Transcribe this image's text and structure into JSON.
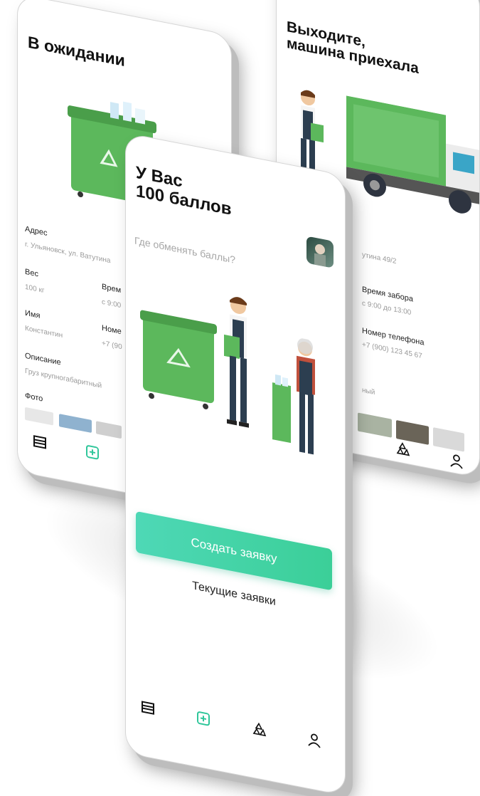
{
  "screens": {
    "waiting": {
      "title": "В ожидании",
      "fields": {
        "address_label": "Адрес",
        "address_value": "г. Ульяновск, ул. Ватутина",
        "weight_label": "Вес",
        "weight_value": "100 кг",
        "time_label": "Врем",
        "time_value": "с 9:00",
        "name_label": "Имя",
        "name_value": "Константин",
        "phone_label": "Номе",
        "phone_value": "+7 (90",
        "description_label": "Описание",
        "description_value": "Груз крупногабаритный",
        "photo_label": "Фото"
      }
    },
    "arrived": {
      "title": "Выходите,\nмашина приехала",
      "fields": {
        "address_value": "утина 49/2",
        "time_label": "Время забора",
        "time_value": "с 9:00 до 13:00",
        "phone_label": "Номер телефона",
        "phone_value": "+7 (900) 123 45 67",
        "description_value": "ный"
      }
    },
    "main": {
      "title": "У Вас\n100 баллов",
      "subtitle": "Где обменять баллы?",
      "create_button": "Создать заявку",
      "current_button": "Текущие заявки"
    }
  },
  "nav": {
    "items": [
      "list-icon",
      "plus-square-icon",
      "recycle-icon",
      "profile-icon"
    ],
    "active_color": "#2fc69a"
  },
  "colors": {
    "accent_start": "#4ed8b6",
    "accent_end": "#3bcf98",
    "bin_green": "#5cb85c"
  }
}
